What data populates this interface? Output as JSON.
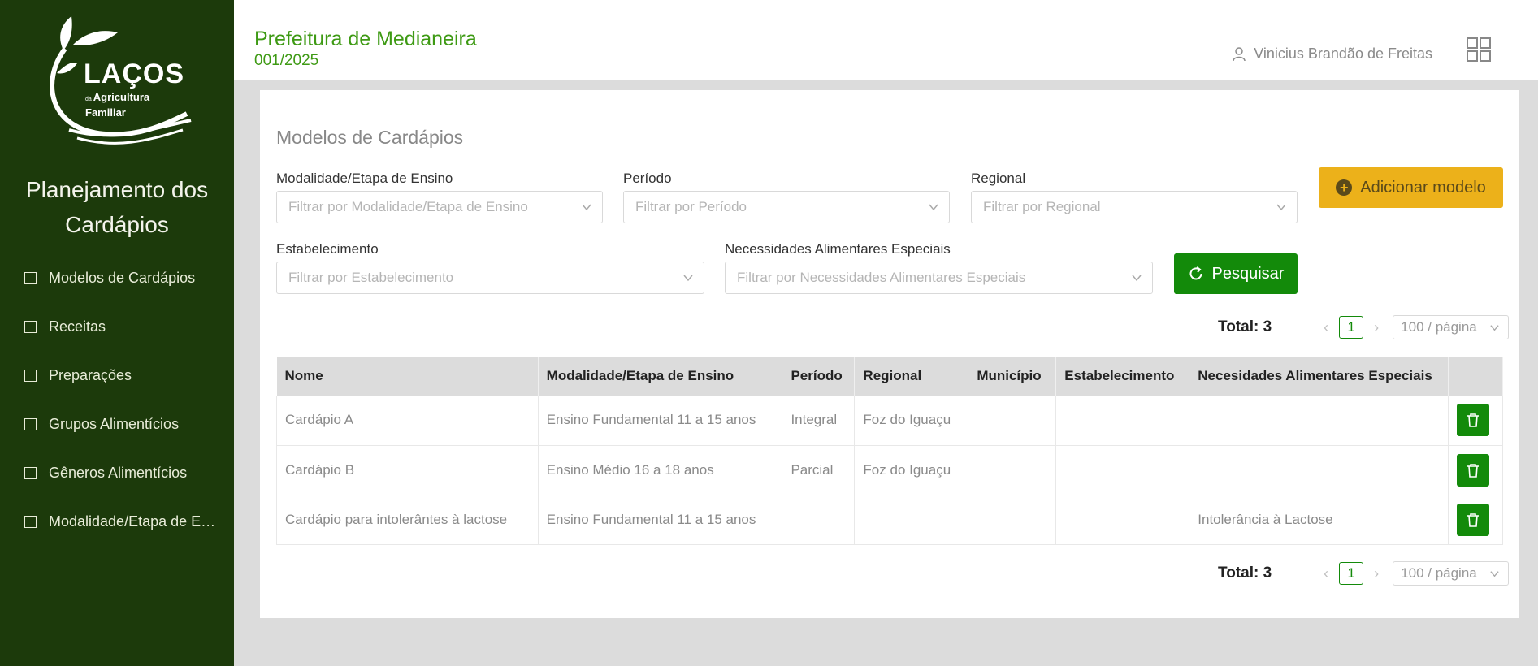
{
  "sidebar": {
    "logo_main": "LAÇOS",
    "logo_small": "da",
    "logo_line1": "Agricultura",
    "logo_line2": "Familiar",
    "title": "Planejamento dos Cardápios",
    "items": [
      {
        "label": "Modelos de Cardápios"
      },
      {
        "label": "Receitas"
      },
      {
        "label": "Preparações"
      },
      {
        "label": "Grupos Alimentícios"
      },
      {
        "label": "Gêneros Alimentícios"
      },
      {
        "label": "Modalidade/Etapa de Ensino"
      }
    ]
  },
  "header": {
    "org": "Prefeitura de Medianeira",
    "code": "001/2025",
    "user": "Vinicius Brandão de Freitas"
  },
  "main": {
    "title": "Modelos de Cardápios",
    "filters": {
      "modalidade": {
        "label": "Modalidade/Etapa de Ensino",
        "placeholder": "Filtrar por Modalidade/Etapa de Ensino"
      },
      "periodo": {
        "label": "Período",
        "placeholder": "Filtrar por Período"
      },
      "regional": {
        "label": "Regional",
        "placeholder": "Filtrar por Regional"
      },
      "estabelecimento": {
        "label": "Estabelecimento",
        "placeholder": "Filtrar por Estabelecimento"
      },
      "necessidades": {
        "label": "Necessidades Alimentares Especiais",
        "placeholder": "Filtrar por Necessidades Alimentares Especiais"
      }
    },
    "add_button": "Adicionar modelo",
    "search_button": "Pesquisar",
    "pagination": {
      "total": "Total: 3",
      "page": "1",
      "per_page": "100 / página"
    },
    "table": {
      "headers": [
        "Nome",
        "Modalidade/Etapa de Ensino",
        "Período",
        "Regional",
        "Município",
        "Estabelecimento",
        "Necesidades Alimentares Especiais",
        ""
      ],
      "rows": [
        [
          "Cardápio A",
          "Ensino Fundamental 11 a 15 anos",
          "Integral",
          "Foz do Iguaçu",
          "",
          "",
          ""
        ],
        [
          "Cardápio B",
          "Ensino Médio 16 a 18 anos",
          "Parcial",
          "Foz do Iguaçu",
          "",
          "",
          ""
        ],
        [
          "Cardápio para intolerântes à lactose",
          "Ensino Fundamental 11 a 15 anos",
          "",
          "",
          "",
          "",
          "Intolerância à Lactose"
        ]
      ]
    }
  },
  "colors": {
    "sidebar": "#1c3a0b",
    "accent_green": "#138a0a",
    "header_green": "#3e9a14",
    "add_yellow": "#ecb11a"
  },
  "icons": [
    "user-icon",
    "apps-grid-icon",
    "chevron-down-icon",
    "plus-circle-icon",
    "refresh-icon",
    "trash-icon"
  ]
}
